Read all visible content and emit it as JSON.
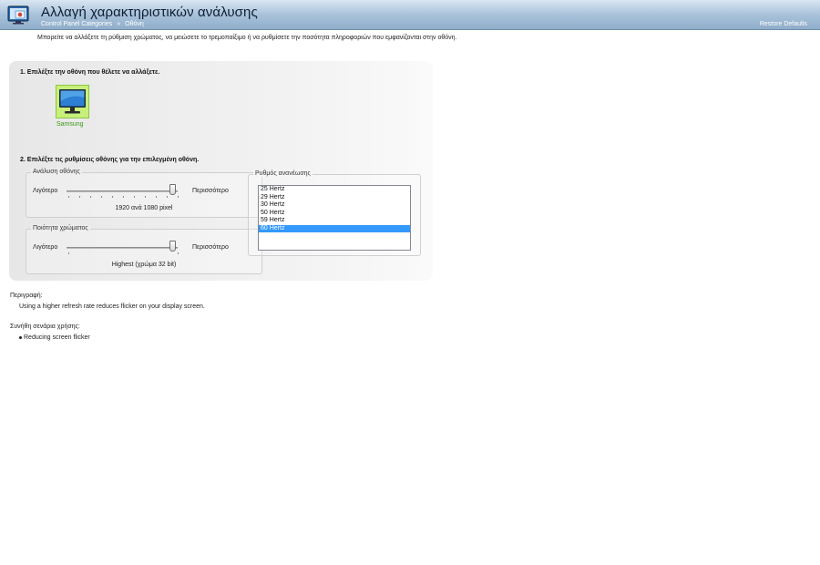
{
  "header": {
    "title": "Αλλαγή χαρακτηριστικών ανάλυσης",
    "breadcrumb": [
      "Control Panel Categories",
      "Οθόνη"
    ],
    "breadcrumb_separator": "»",
    "restore_label": "Restore Defaults",
    "icon": "display-settings-icon"
  },
  "intro": "Μπορείτε να αλλάξετε τη ρύθμιση χρώματος, να μειώσετε το τρεμοπαίξιμο ή να ρυθμίσετε την ποσότητα πληροφοριών που εμφανίζονται στην οθόνη.",
  "step1": {
    "title": "1. Επιλέξτε την οθόνη που θέλετε να αλλάξετε.",
    "display_label": "Samsung",
    "display_icon": "monitor-icon"
  },
  "step2": {
    "title": "2. Επιλέξτε τις ρυθμίσεις οθόνης για την επιλεγμένη οθόνη.",
    "resolution": {
      "title": "Ανάλυση οθόνης",
      "less": "Λιγότερο",
      "more": "Περισσότερο",
      "value": "1920 ανά 1080 pixel",
      "level": 0.95
    },
    "color": {
      "title": "Ποιότητα χρώματος",
      "less": "Λιγότερο",
      "more": "Περισσότερο",
      "value": "Highest (χρώμα 32 bit)",
      "level": 0.95
    },
    "refresh": {
      "title": "Ρυθμός ανανέωσης",
      "options": [
        "25 Hertz",
        "29 Hertz",
        "30 Hertz",
        "50 Hertz",
        "59 Hertz",
        "60 Hertz"
      ],
      "selected": "60 Hertz"
    }
  },
  "description": {
    "heading": "Περιγραφή:",
    "text": "Using a higher refresh rate reduces flicker on your display screen."
  },
  "usage": {
    "heading": "Συνήθη σενάρια χρήσης:",
    "items": [
      "Reducing screen flicker"
    ]
  },
  "colors": {
    "accent": "#3399ff",
    "link_green": "#3a9a14",
    "header_top": "#d8e6f2",
    "header_bottom": "#8fadc9"
  }
}
